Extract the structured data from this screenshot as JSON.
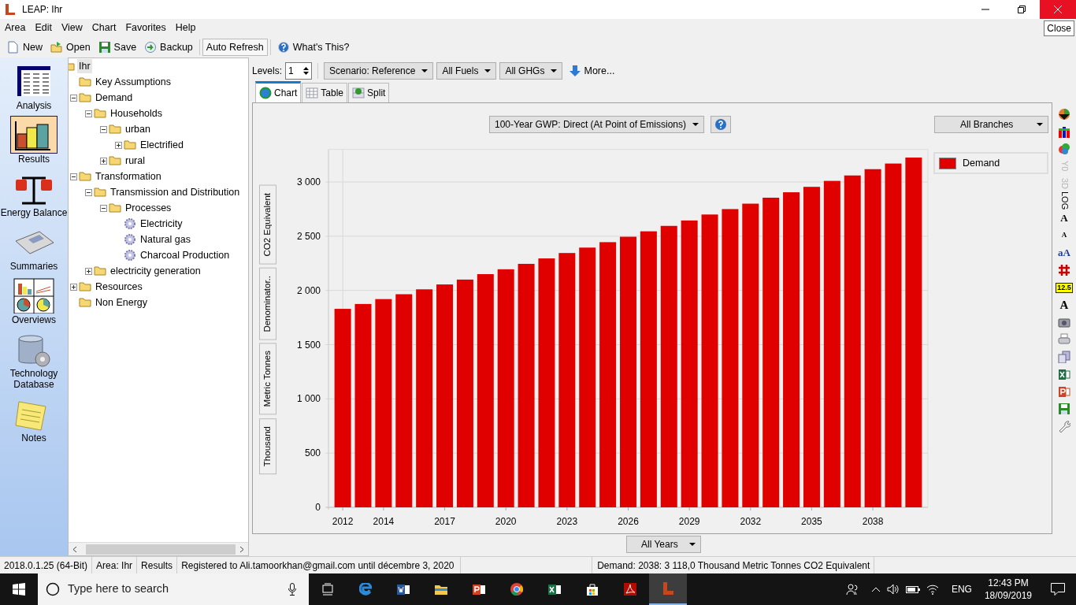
{
  "window": {
    "title": "LEAP: Ihr",
    "close_tooltip": "Close"
  },
  "menu": [
    "Area",
    "Edit",
    "View",
    "Chart",
    "Favorites",
    "Help"
  ],
  "toolbar": [
    {
      "kind": "new",
      "label": "New"
    },
    {
      "kind": "open",
      "label": "Open"
    },
    {
      "kind": "save",
      "label": "Save"
    },
    {
      "kind": "backup",
      "label": "Backup"
    },
    {
      "kind": "toggle",
      "label": "Auto Refresh",
      "on": true
    },
    {
      "kind": "help",
      "label": "What's This?"
    }
  ],
  "views": [
    {
      "kind": "analysis",
      "label": "Analysis",
      "selected": false
    },
    {
      "kind": "results",
      "label": "Results",
      "selected": true
    },
    {
      "kind": "balance",
      "label": "Energy Balance",
      "selected": false
    },
    {
      "kind": "summaries",
      "label": "Summaries",
      "selected": false
    },
    {
      "kind": "overviews",
      "label": "Overviews",
      "selected": false
    },
    {
      "kind": "database",
      "label": "Technology Database",
      "selected": false
    },
    {
      "kind": "notes",
      "label": "Notes",
      "selected": false
    }
  ],
  "tree": {
    "label": "Ihr",
    "kind": "folder",
    "selected": true,
    "children": [
      {
        "label": "Key Assumptions",
        "kind": "folder",
        "selected": false
      },
      {
        "label": "Demand",
        "kind": "folder",
        "selected": false,
        "expanded": true,
        "children": [
          {
            "label": "Households",
            "kind": "folder",
            "selected": false,
            "expanded": true,
            "children": [
              {
                "label": "urban",
                "kind": "folder",
                "selected": false,
                "expanded": true,
                "children": [
                  {
                    "label": "Electrified",
                    "kind": "folder",
                    "selected": false,
                    "expanded": false
                  }
                ]
              },
              {
                "label": "rural",
                "kind": "folder",
                "selected": false,
                "expanded": false
              }
            ]
          }
        ]
      },
      {
        "label": "Transformation",
        "kind": "folder",
        "selected": false,
        "expanded": true,
        "children": [
          {
            "label": "Transmission and Distribution",
            "kind": "folder",
            "selected": false,
            "expanded": true,
            "children": [
              {
                "label": "Processes",
                "kind": "folder",
                "selected": false,
                "expanded": true,
                "children": [
                  {
                    "label": "Electricity",
                    "kind": "process",
                    "selected": false
                  },
                  {
                    "label": "Natural gas",
                    "kind": "process",
                    "selected": false
                  },
                  {
                    "label": "Charcoal Production",
                    "kind": "process",
                    "selected": false
                  }
                ]
              }
            ]
          },
          {
            "label": "electricity generation",
            "kind": "folder",
            "selected": false,
            "expanded": false
          }
        ]
      },
      {
        "label": "Resources",
        "kind": "folder",
        "selected": false,
        "expanded": false
      },
      {
        "label": "Non Energy",
        "kind": "folder",
        "selected": false
      }
    ]
  },
  "controls": {
    "levels_label": "Levels:",
    "levels": "1",
    "dropdowns": [
      "Scenario: Reference",
      "All Fuels",
      "All GHGs"
    ],
    "more": "More..."
  },
  "tabs": [
    {
      "kind": "chart",
      "label": "Chart",
      "selected": true
    },
    {
      "kind": "table",
      "label": "Table",
      "selected": false
    },
    {
      "kind": "split",
      "label": "Split",
      "selected": false
    }
  ],
  "chart_panel": {
    "gwp": "100-Year GWP: Direct (At Point of Emissions)",
    "branches": "All Branches",
    "axis_buttons": [
      "CO2 Equivalent",
      "Denominator..",
      "Metric Tonnes",
      "Thousand"
    ],
    "chart_data": {
      "type": "bar",
      "x": [
        2012,
        2013,
        2014,
        2015,
        2016,
        2017,
        2018,
        2019,
        2020,
        2021,
        2022,
        2023,
        2024,
        2025,
        2026,
        2027,
        2028,
        2029,
        2030,
        2031,
        2032,
        2033,
        2034,
        2035,
        2036,
        2037,
        2038,
        2039,
        2040
      ],
      "grid": true,
      "xlim": [
        2011.3,
        2040.7
      ],
      "series": [
        {
          "name": "Demand",
          "color": "#e00000",
          "values": [
            1830,
            1875,
            1920,
            1965,
            2010,
            2055,
            2100,
            2150,
            2195,
            2245,
            2295,
            2345,
            2395,
            2445,
            2495,
            2545,
            2595,
            2645,
            2700,
            2750,
            2800,
            2855,
            2905,
            2955,
            3010,
            3060,
            3118,
            3170,
            3225
          ]
        }
      ],
      "xticks": [
        2012,
        2014,
        2017,
        2020,
        2023,
        2026,
        2029,
        2032,
        2035,
        2038
      ],
      "yticks": [
        {
          "value": 0,
          "label": "0"
        },
        {
          "value": 500,
          "label": "500"
        },
        {
          "value": 1000,
          "label": "1 000"
        },
        {
          "value": 1500,
          "label": "1 500"
        },
        {
          "value": 2000,
          "label": "2 000"
        },
        {
          "value": 2500,
          "label": "2 500"
        },
        {
          "value": 3000,
          "label": "3 000"
        }
      ],
      "ylim": [
        0,
        3300
      ]
    },
    "years": "All Years"
  },
  "chart_tools": [
    {
      "kind": "pie"
    },
    {
      "kind": "bars"
    },
    {
      "kind": "shapes"
    },
    {
      "kind": "text",
      "label": "Y0",
      "disabled": true
    },
    {
      "kind": "text",
      "label": "3D",
      "disabled": true
    },
    {
      "kind": "text",
      "label": "LOG",
      "disabled": false
    },
    {
      "kind": "font_up",
      "label": "A"
    },
    {
      "kind": "font_down",
      "label": "A"
    },
    {
      "kind": "font_color",
      "label": "aA"
    },
    {
      "kind": "grid"
    },
    {
      "kind": "value",
      "label": "12.5"
    },
    {
      "kind": "rotate",
      "label": "A"
    },
    {
      "kind": "camera"
    },
    {
      "kind": "print"
    },
    {
      "kind": "copy"
    },
    {
      "kind": "excel"
    },
    {
      "kind": "powerpoint"
    },
    {
      "kind": "save"
    },
    {
      "kind": "wrench"
    }
  ],
  "status_bar": [
    "2018.0.1.25 (64-Bit)",
    "Area: Ihr",
    "Results",
    "Registered to Ali.tamoorkhan@gmail.com until décembre 3, 2020",
    "Demand: 2038: 3 118,0 Thousand Metric Tonnes CO2 Equivalent"
  ],
  "taskbar": {
    "search": "Type here to search",
    "apps": [
      {
        "kind": "taskview",
        "active": false
      },
      {
        "kind": "edge",
        "active": false
      },
      {
        "kind": "word",
        "active": false
      },
      {
        "kind": "explorer",
        "active": false
      },
      {
        "kind": "powerpoint",
        "active": false
      },
      {
        "kind": "chrome",
        "active": false
      },
      {
        "kind": "excel",
        "active": false
      },
      {
        "kind": "store",
        "active": false
      },
      {
        "kind": "acrobat",
        "active": false
      },
      {
        "kind": "leap",
        "active": true
      }
    ],
    "language": "ENG",
    "time": "12:43 PM",
    "date": "18/09/2019"
  }
}
